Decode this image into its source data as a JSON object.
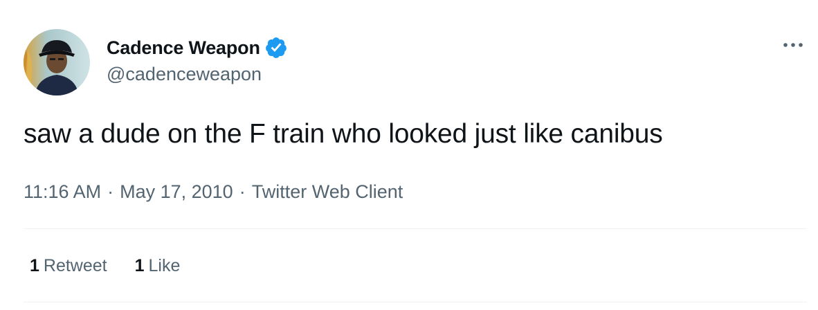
{
  "author": {
    "display_name": "Cadence Weapon",
    "handle": "@cadenceweapon",
    "verified": true,
    "verified_color": "#1d9bf0",
    "avatar_icon": "profile-photo"
  },
  "tweet": {
    "text": "saw a dude on the F train who looked just like canibus"
  },
  "meta": {
    "time": "11:16 AM",
    "separator": "·",
    "date": "May 17, 2010",
    "source": "Twitter Web Client"
  },
  "stats": {
    "retweets": {
      "count": "1",
      "label": "Retweet"
    },
    "likes": {
      "count": "1",
      "label": "Like"
    }
  },
  "menu": {
    "icon": "more-icon"
  }
}
